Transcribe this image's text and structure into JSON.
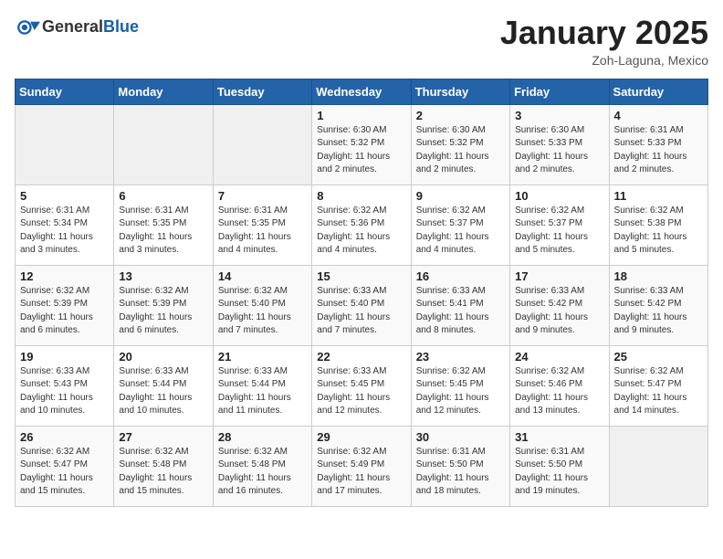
{
  "header": {
    "logo_general": "General",
    "logo_blue": "Blue",
    "month_year": "January 2025",
    "location": "Zoh-Laguna, Mexico"
  },
  "days_of_week": [
    "Sunday",
    "Monday",
    "Tuesday",
    "Wednesday",
    "Thursday",
    "Friday",
    "Saturday"
  ],
  "weeks": [
    [
      {
        "day": "",
        "info": ""
      },
      {
        "day": "",
        "info": ""
      },
      {
        "day": "",
        "info": ""
      },
      {
        "day": "1",
        "info": "Sunrise: 6:30 AM\nSunset: 5:32 PM\nDaylight: 11 hours\nand 2 minutes."
      },
      {
        "day": "2",
        "info": "Sunrise: 6:30 AM\nSunset: 5:32 PM\nDaylight: 11 hours\nand 2 minutes."
      },
      {
        "day": "3",
        "info": "Sunrise: 6:30 AM\nSunset: 5:33 PM\nDaylight: 11 hours\nand 2 minutes."
      },
      {
        "day": "4",
        "info": "Sunrise: 6:31 AM\nSunset: 5:33 PM\nDaylight: 11 hours\nand 2 minutes."
      }
    ],
    [
      {
        "day": "5",
        "info": "Sunrise: 6:31 AM\nSunset: 5:34 PM\nDaylight: 11 hours\nand 3 minutes."
      },
      {
        "day": "6",
        "info": "Sunrise: 6:31 AM\nSunset: 5:35 PM\nDaylight: 11 hours\nand 3 minutes."
      },
      {
        "day": "7",
        "info": "Sunrise: 6:31 AM\nSunset: 5:35 PM\nDaylight: 11 hours\nand 4 minutes."
      },
      {
        "day": "8",
        "info": "Sunrise: 6:32 AM\nSunset: 5:36 PM\nDaylight: 11 hours\nand 4 minutes."
      },
      {
        "day": "9",
        "info": "Sunrise: 6:32 AM\nSunset: 5:37 PM\nDaylight: 11 hours\nand 4 minutes."
      },
      {
        "day": "10",
        "info": "Sunrise: 6:32 AM\nSunset: 5:37 PM\nDaylight: 11 hours\nand 5 minutes."
      },
      {
        "day": "11",
        "info": "Sunrise: 6:32 AM\nSunset: 5:38 PM\nDaylight: 11 hours\nand 5 minutes."
      }
    ],
    [
      {
        "day": "12",
        "info": "Sunrise: 6:32 AM\nSunset: 5:39 PM\nDaylight: 11 hours\nand 6 minutes."
      },
      {
        "day": "13",
        "info": "Sunrise: 6:32 AM\nSunset: 5:39 PM\nDaylight: 11 hours\nand 6 minutes."
      },
      {
        "day": "14",
        "info": "Sunrise: 6:32 AM\nSunset: 5:40 PM\nDaylight: 11 hours\nand 7 minutes."
      },
      {
        "day": "15",
        "info": "Sunrise: 6:33 AM\nSunset: 5:40 PM\nDaylight: 11 hours\nand 7 minutes."
      },
      {
        "day": "16",
        "info": "Sunrise: 6:33 AM\nSunset: 5:41 PM\nDaylight: 11 hours\nand 8 minutes."
      },
      {
        "day": "17",
        "info": "Sunrise: 6:33 AM\nSunset: 5:42 PM\nDaylight: 11 hours\nand 9 minutes."
      },
      {
        "day": "18",
        "info": "Sunrise: 6:33 AM\nSunset: 5:42 PM\nDaylight: 11 hours\nand 9 minutes."
      }
    ],
    [
      {
        "day": "19",
        "info": "Sunrise: 6:33 AM\nSunset: 5:43 PM\nDaylight: 11 hours\nand 10 minutes."
      },
      {
        "day": "20",
        "info": "Sunrise: 6:33 AM\nSunset: 5:44 PM\nDaylight: 11 hours\nand 10 minutes."
      },
      {
        "day": "21",
        "info": "Sunrise: 6:33 AM\nSunset: 5:44 PM\nDaylight: 11 hours\nand 11 minutes."
      },
      {
        "day": "22",
        "info": "Sunrise: 6:33 AM\nSunset: 5:45 PM\nDaylight: 11 hours\nand 12 minutes."
      },
      {
        "day": "23",
        "info": "Sunrise: 6:32 AM\nSunset: 5:45 PM\nDaylight: 11 hours\nand 12 minutes."
      },
      {
        "day": "24",
        "info": "Sunrise: 6:32 AM\nSunset: 5:46 PM\nDaylight: 11 hours\nand 13 minutes."
      },
      {
        "day": "25",
        "info": "Sunrise: 6:32 AM\nSunset: 5:47 PM\nDaylight: 11 hours\nand 14 minutes."
      }
    ],
    [
      {
        "day": "26",
        "info": "Sunrise: 6:32 AM\nSunset: 5:47 PM\nDaylight: 11 hours\nand 15 minutes."
      },
      {
        "day": "27",
        "info": "Sunrise: 6:32 AM\nSunset: 5:48 PM\nDaylight: 11 hours\nand 15 minutes."
      },
      {
        "day": "28",
        "info": "Sunrise: 6:32 AM\nSunset: 5:48 PM\nDaylight: 11 hours\nand 16 minutes."
      },
      {
        "day": "29",
        "info": "Sunrise: 6:32 AM\nSunset: 5:49 PM\nDaylight: 11 hours\nand 17 minutes."
      },
      {
        "day": "30",
        "info": "Sunrise: 6:31 AM\nSunset: 5:50 PM\nDaylight: 11 hours\nand 18 minutes."
      },
      {
        "day": "31",
        "info": "Sunrise: 6:31 AM\nSunset: 5:50 PM\nDaylight: 11 hours\nand 19 minutes."
      },
      {
        "day": "",
        "info": ""
      }
    ]
  ]
}
